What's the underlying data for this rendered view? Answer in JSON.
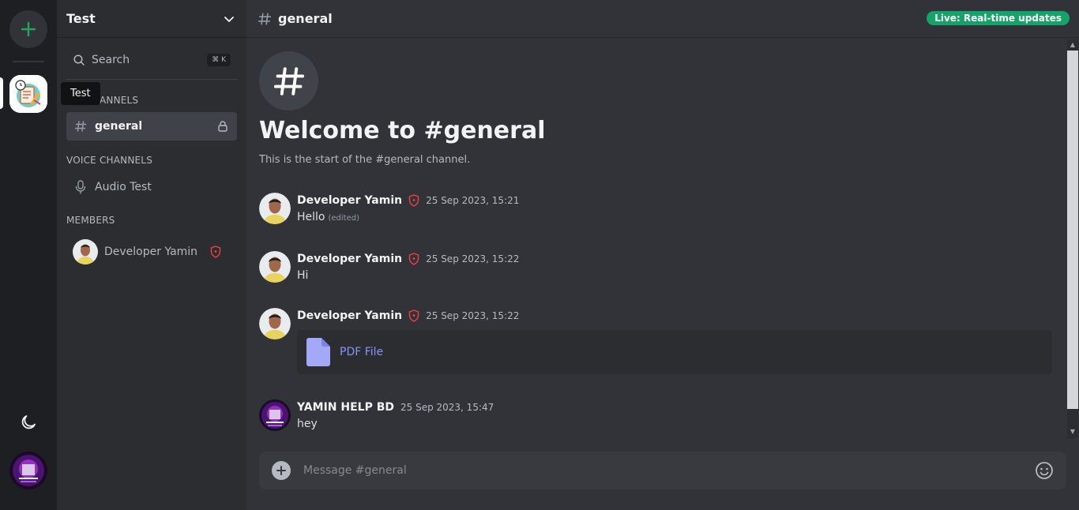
{
  "rail": {
    "add_server_icon": "plus-icon",
    "theme_icon": "moon-icon"
  },
  "server": {
    "name": "Test",
    "tooltip": "Test"
  },
  "search": {
    "label": "Search",
    "shortcut": "⌘ K"
  },
  "sections": {
    "text_channels": "TEXT CHANNELS",
    "text_channels_visible": "ANNELS",
    "voice_channels": "VOICE CHANNELS",
    "members": "MEMBERS"
  },
  "channels": {
    "text": [
      {
        "name": "general",
        "locked": true
      }
    ],
    "voice": [
      {
        "name": "Audio Test"
      }
    ]
  },
  "members": [
    {
      "name": "Developer Yamin",
      "role_icon": "shield-icon"
    }
  ],
  "topbar": {
    "channel": "general",
    "live_badge": "Live: Real-time updates"
  },
  "welcome": {
    "title": "Welcome to #general",
    "subtitle": "This is the start of the #general channel."
  },
  "messages": [
    {
      "author": "Developer Yamin",
      "time": "25 Sep 2023, 15:21",
      "text": "Hello",
      "edited": "(edited)"
    },
    {
      "author": "Developer Yamin",
      "time": "25 Sep 2023, 15:22",
      "text": "Hi"
    },
    {
      "author": "Developer Yamin",
      "time": "25 Sep 2023, 15:22",
      "attachment": "PDF File"
    },
    {
      "author": "YAMIN HELP BD",
      "time": "25 Sep 2023, 15:47",
      "text": "hey"
    }
  ],
  "composer": {
    "placeholder": "Message #general"
  },
  "colors": {
    "accent": "#23a55a",
    "live": "#16a36a",
    "link": "#8a94f5",
    "shield": "#f23f43"
  }
}
